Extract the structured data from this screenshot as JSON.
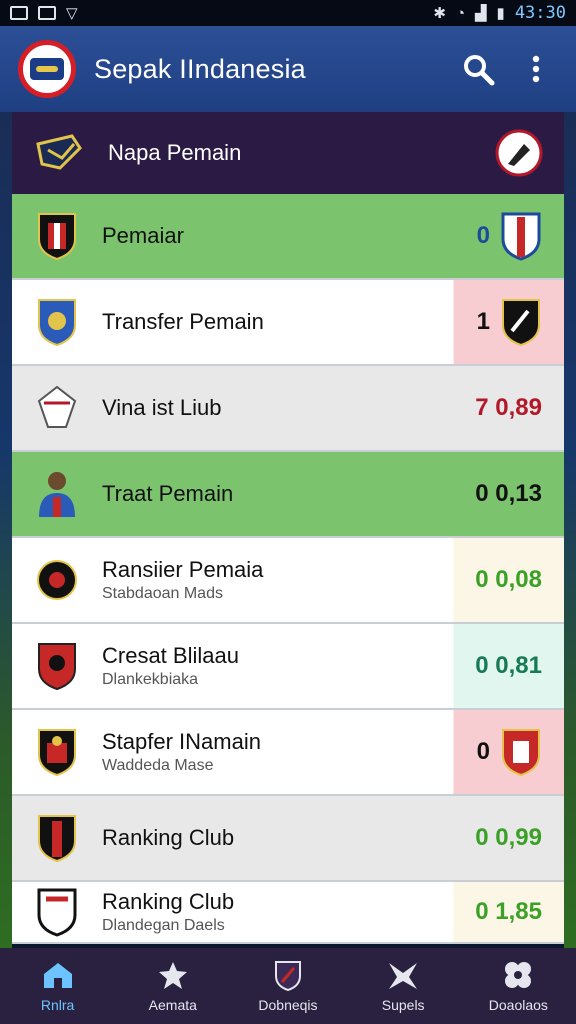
{
  "statusbar": {
    "time": "43:30"
  },
  "appbar": {
    "title": "Sepak IIndanesia"
  },
  "subheader": {
    "title": "Napa Pemain"
  },
  "rows": [
    {
      "primary": "Pemaiar",
      "secondary": "",
      "value": "0",
      "style": "green"
    },
    {
      "primary": "Transfer Pemain",
      "secondary": "",
      "value": "1",
      "style": "white"
    },
    {
      "primary": "Vina ist Liub",
      "secondary": "",
      "value": "7 0,89",
      "style": "grey"
    },
    {
      "primary": "Traat Pemain",
      "secondary": "",
      "value": "0 0,13",
      "style": "green"
    },
    {
      "primary": "Ransiier Pemaia",
      "secondary": "Stabdaoan Mads",
      "value": "0 0,08",
      "style": "white"
    },
    {
      "primary": "Cresat Blilaau",
      "secondary": "Dlankekbiaka",
      "value": "0 0,81",
      "style": "white"
    },
    {
      "primary": "Stapfer INamain",
      "secondary": "Waddeda Mase",
      "value": "0",
      "style": "white"
    },
    {
      "primary": "Ranking Club",
      "secondary": "",
      "value": "0 0,99",
      "style": "grey"
    },
    {
      "primary": "Ranking Club",
      "secondary": "Dlandegan Daels",
      "value": "0 1,85",
      "style": "white"
    }
  ],
  "bottomnav": [
    {
      "label": "Rnlra",
      "icon": "home-icon"
    },
    {
      "label": "Aemata",
      "icon": "star-icon"
    },
    {
      "label": "Dobneqis",
      "icon": "shield-icon"
    },
    {
      "label": "Supels",
      "icon": "shuttle-icon"
    },
    {
      "label": "Doaolaos",
      "icon": "ball-icon"
    }
  ],
  "colors": {
    "appbar": "#2c4f96",
    "subheader": "#2a1a44",
    "green_row": "#7cc36e",
    "accent": "#6cc3ff"
  }
}
